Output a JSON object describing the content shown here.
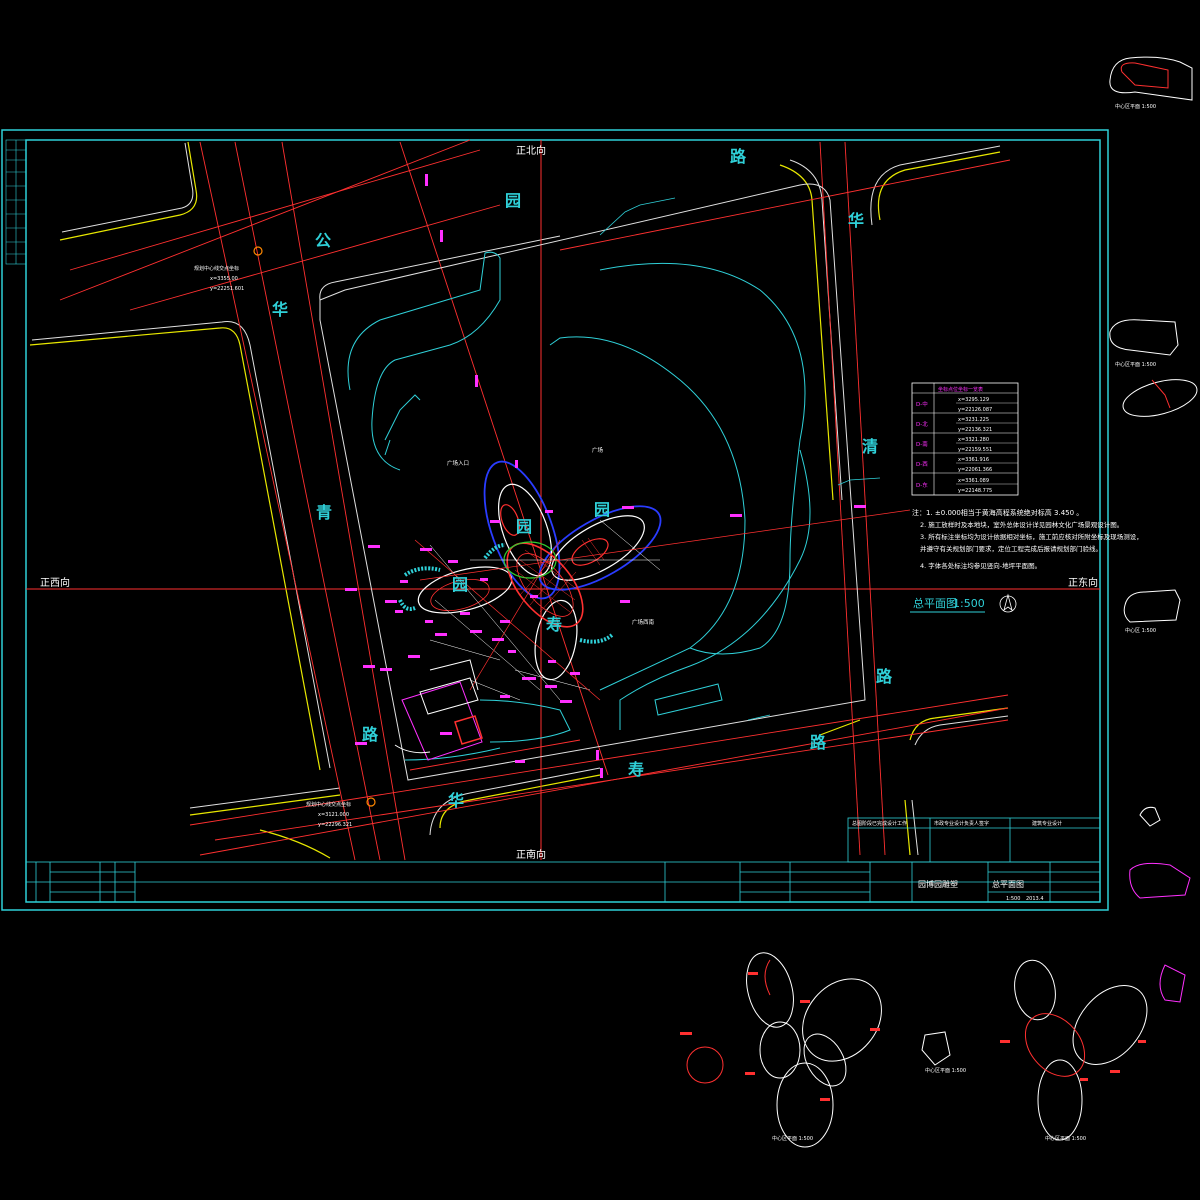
{
  "directions": {
    "north": "正北向",
    "south": "正南向",
    "west": "正西向",
    "east": "正东向"
  },
  "roads": {
    "north_road": [
      "公",
      "园",
      "路"
    ],
    "west_road": [
      "华",
      "青",
      "路"
    ],
    "east_road": [
      "华",
      "清",
      "路"
    ],
    "south_road": [
      "华",
      "寿",
      "路"
    ]
  },
  "plaza_label": "广场",
  "plaza_left_label": "广场入口",
  "plaza_right_label": "广场西南",
  "map_title": "总平面图",
  "map_scale": "1:500",
  "control_points": {
    "northwest": {
      "label": "规划中心线交点坐标",
      "x": "x=3355.00",
      "y": "y=22251.601"
    },
    "southwest": {
      "label": "规划中心线交点坐标",
      "x": "x=3121.000",
      "y": "y=22296.321"
    }
  },
  "coord_table": {
    "header": "坐标点位坐标一览表",
    "rows": [
      {
        "name": "D-中",
        "values": [
          "x=3295.129",
          "y=22126.087"
        ]
      },
      {
        "name": "D-北",
        "values": [
          "x=3231.225",
          "y=22136.321"
        ]
      },
      {
        "name": "D-南",
        "values": [
          "x=3321.280",
          "y=22159.551"
        ]
      },
      {
        "name": "D-西",
        "values": [
          "x=3361.916",
          "y=22061.366"
        ]
      },
      {
        "name": "D-东",
        "values": [
          "x=3361.089",
          "y=22148.775"
        ]
      }
    ]
  },
  "notes": [
    "注：1. ±0.000相当于黄海高程系统绝对标高 3.450 。",
    "2. 施工放样时及本地块，室外总体设计详见园林文化广场景观设计图。",
    "3. 所有标注坐标均为设计依据相对坐标，施工前应核对所附坐标及现场测设，",
    "   并遵守有关规划部门要求，定位工程完成后报请规划部门验线。",
    "4. 字体各处标注均参见竖向-地坪平面图。"
  ],
  "bottom_strip": {
    "cells": [
      "总图阶段已完成设计工作",
      "市政专业设计负责人签字",
      "建筑专业设计"
    ]
  },
  "title_block": {
    "project": "园博园雕塑",
    "drawing": "总平面图",
    "scale": "1:500",
    "date": "2013.4"
  },
  "detail_labels": {
    "d1": "中心区平面 1:500",
    "d2": "中心区平面 1:500",
    "d3": "中心区 1:500",
    "d4": "中心区平面 1:500",
    "d5": "中心区平面 1:500",
    "d6": "中心区平面 1:500"
  },
  "colors": {
    "background": "#000000",
    "frame": "#2fd0d8",
    "red": "#ff3030",
    "magenta": "#ff30ff",
    "yellow": "#f0f000",
    "blue": "#2a3cff",
    "green": "#30d030",
    "white": "#ffffff"
  }
}
